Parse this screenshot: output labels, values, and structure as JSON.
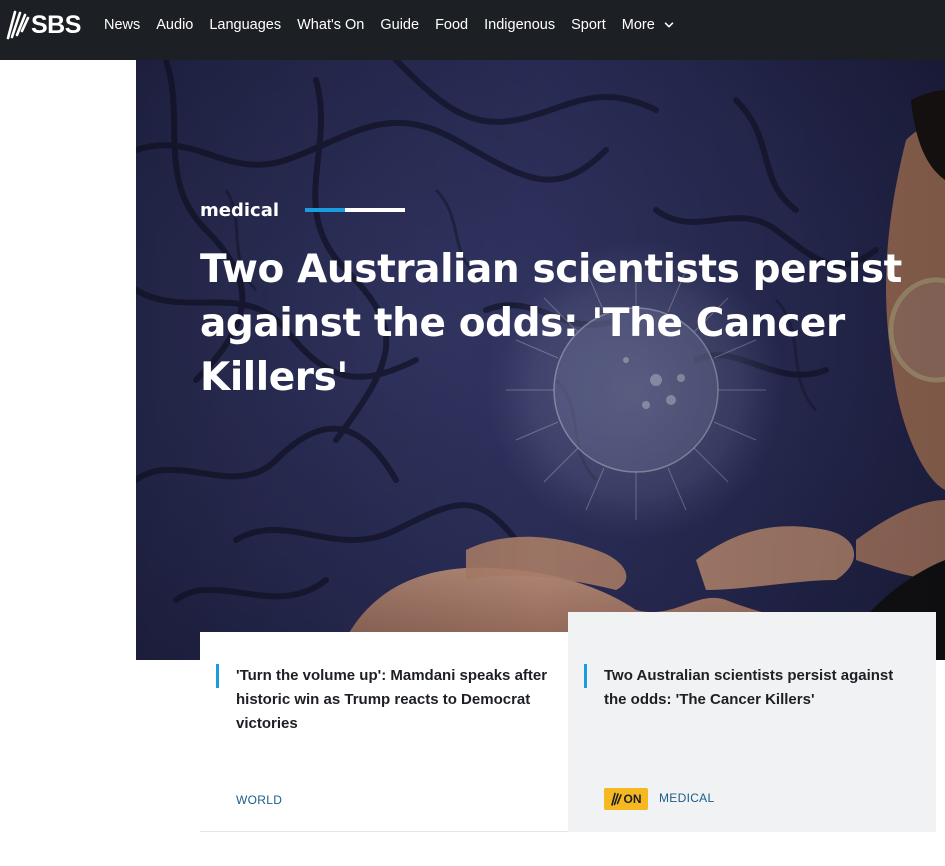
{
  "brand": {
    "logo_text": "SBS"
  },
  "nav": {
    "items": [
      "News",
      "Audio",
      "Languages",
      "What's On",
      "Guide",
      "Food",
      "Indigenous",
      "Sport"
    ],
    "more_label": "More"
  },
  "hero": {
    "category": "medical",
    "title": "Two Australian scientists persist against the odds: 'The Cancer Killers'"
  },
  "cards": [
    {
      "title": "'Turn the volume up': Mamdani speaks after historic win as Trump reacts to Democrat victories",
      "tag": "WORLD"
    },
    {
      "title": "Two Australian scientists persist against the odds: 'The Cancer Killers'",
      "badge": "ON",
      "tag": "MEDICAL"
    }
  ],
  "colors": {
    "topbar": "#1c1f24",
    "accent": "#1b9be0",
    "tag": "#1a5d8a",
    "badge": "#f5b820"
  },
  "icons": {
    "logo": "sbs-waves-icon",
    "more": "chevron-down-icon"
  }
}
